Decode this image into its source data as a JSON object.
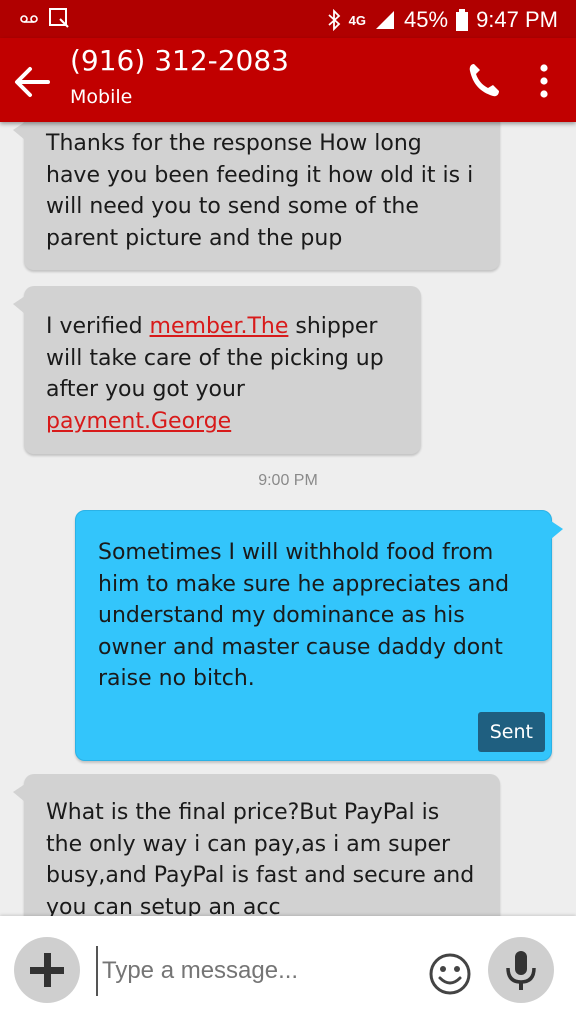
{
  "status_bar": {
    "network": "4G",
    "battery": "45%",
    "time": "9:47 PM"
  },
  "header": {
    "contact": "(916) 312-2083",
    "subtitle": "Mobile"
  },
  "messages": [
    {
      "direction": "incoming",
      "segments": [
        {
          "text": "Thanks for the response How long have you been feeding it how old it is i will need you to send some of the parent picture and the pup"
        }
      ]
    },
    {
      "direction": "incoming",
      "segments": [
        {
          "text": "I verified "
        },
        {
          "text": "member.The",
          "link": true
        },
        {
          "text": " shipper will take care of the picking up after you got your "
        },
        {
          "text": "payment.George",
          "link": true
        }
      ]
    },
    {
      "direction": "outgoing",
      "segments": [
        {
          "text": "Sometimes I will withhold food from him to make sure he appreciates and understand my dominance as his owner and master cause daddy dont raise no bitch."
        }
      ],
      "status": "Sent"
    },
    {
      "direction": "incoming",
      "segments": [
        {
          "text": "What is the final price?But PayPal is the only way i can pay,as i am super busy,and PayPal is fast and secure and you can setup an acc"
        }
      ]
    }
  ],
  "time_divider": "9:00 PM",
  "composer": {
    "placeholder": "Type a message..."
  },
  "colors": {
    "app_bar": "#c10000",
    "status_bar": "#b00000",
    "incoming_bubble": "#d2d2d2",
    "outgoing_bubble": "#33c5fb",
    "sent_badge": "#1f5f80",
    "link": "#d81a1a"
  },
  "icons": {
    "back": "arrow-back-icon",
    "call": "phone-icon",
    "more": "more-vert-icon",
    "add": "plus-icon",
    "emoji": "smiley-icon",
    "mic": "microphone-icon"
  }
}
